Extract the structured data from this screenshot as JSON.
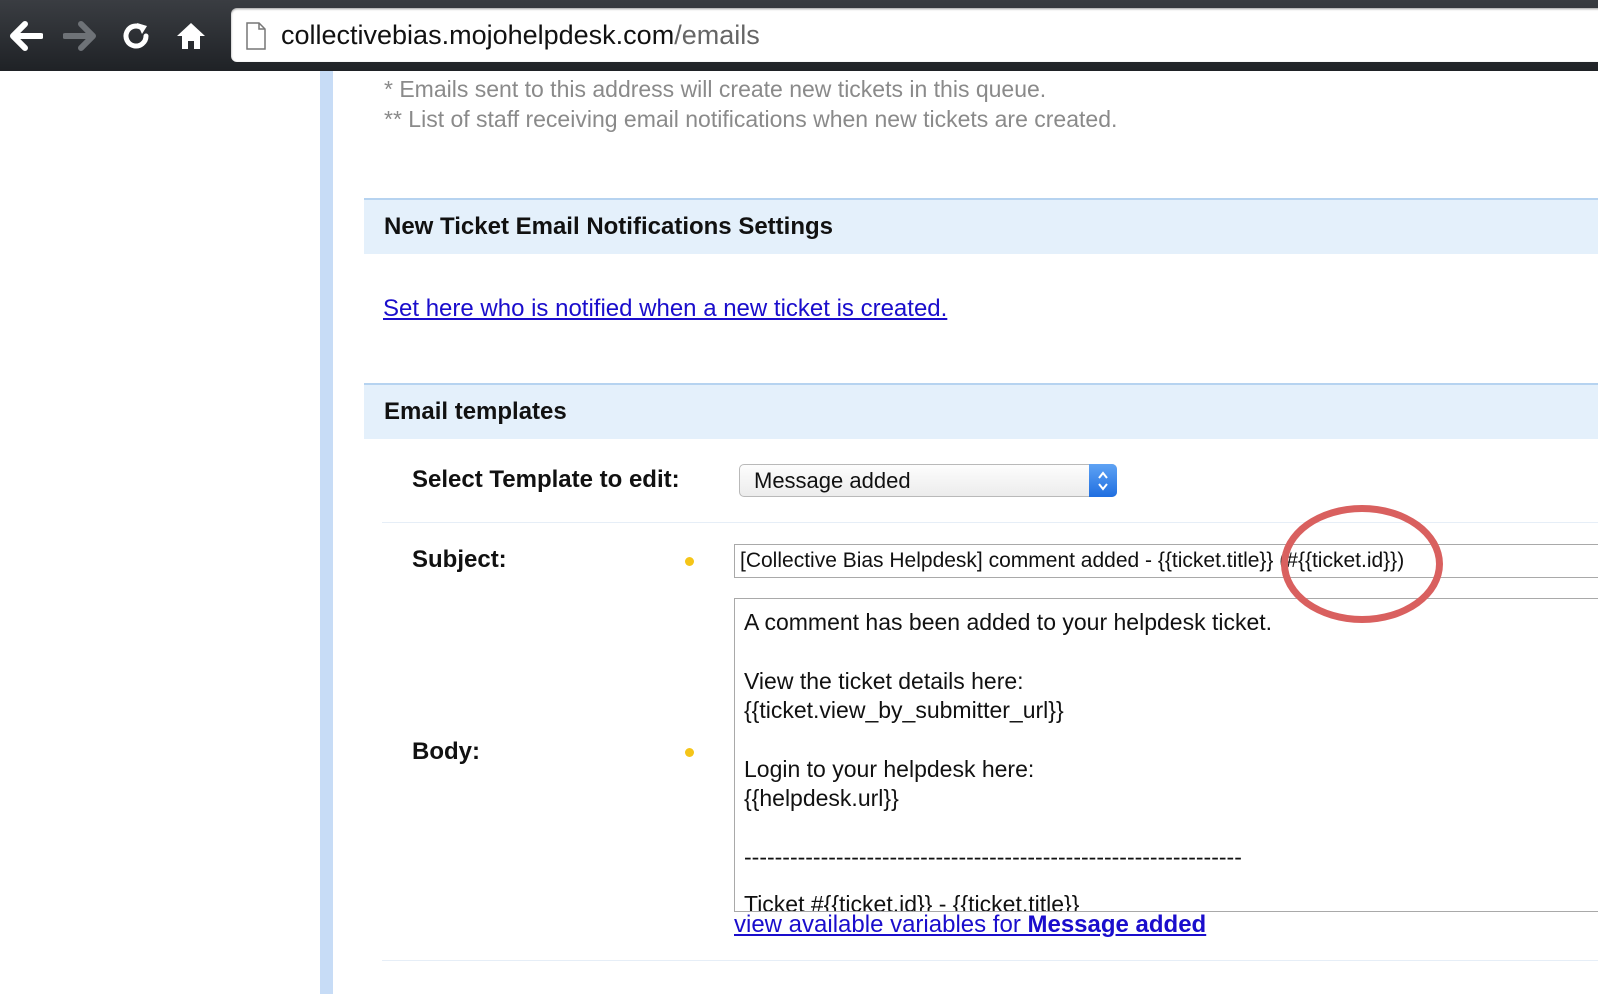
{
  "browser": {
    "url_host": "collectivebias.mojohelpdesk.com",
    "url_path": "/emails"
  },
  "notes": {
    "line1": "* Emails sent to this address will create new tickets in this queue.",
    "line2": "** List of staff receiving email notifications when new tickets are created."
  },
  "notifications_section": {
    "title": "New Ticket Email Notifications Settings",
    "link": "Set here who is notified when a new ticket is created."
  },
  "templates_section": {
    "title": "Email templates",
    "select_label": "Select Template to edit:",
    "selected_template": "Message added",
    "subject_label": "Subject:",
    "subject_value": "[Collective Bias Helpdesk] comment added - {{ticket.title}} (#{{ticket.id}})",
    "body_label": "Body:",
    "body_lines": [
      "A comment has been added to your helpdesk ticket.",
      "",
      "View the ticket details here:",
      "{{ticket.view_by_submitter_url}}",
      "",
      "Login to your helpdesk here:",
      "{{helpdesk.url}}",
      "",
      "-----------------------------------------------------------------",
      "",
      "Ticket #{{ticket.id}} - {{ticket.title}}"
    ],
    "variables_link_prefix": "view available variables for ",
    "variables_link_strong": "Message added"
  },
  "colors": {
    "link": "#1a0dcc",
    "section_bg": "#e4f0fb",
    "rail": "#c7dcf6",
    "annotation_circle": "#d9605f",
    "required_dot": "#f5c518"
  }
}
